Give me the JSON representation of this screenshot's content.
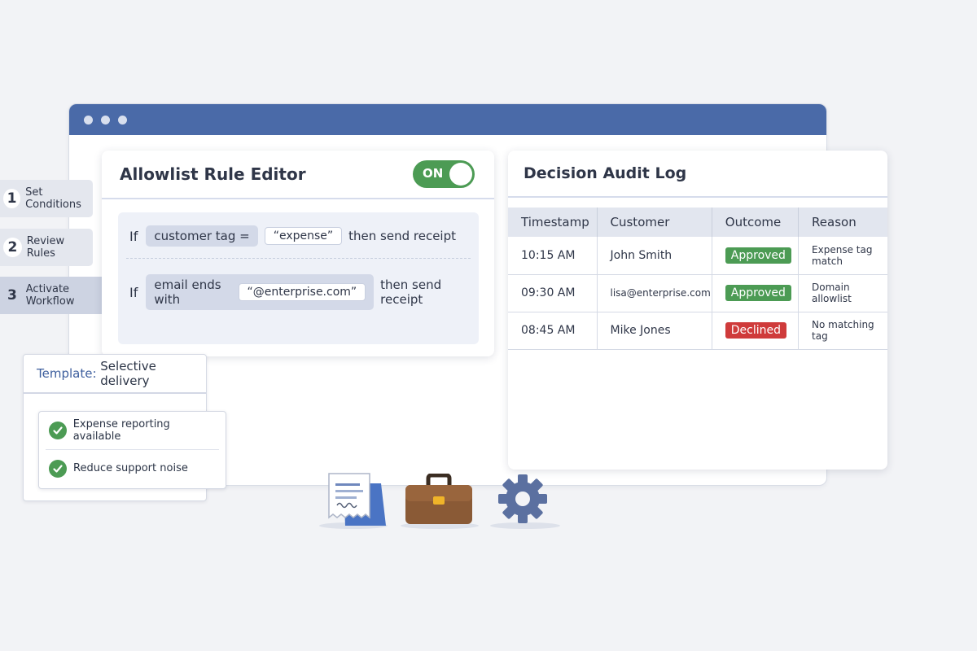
{
  "steps": [
    {
      "number": "1",
      "label": "Set Conditions"
    },
    {
      "number": "2",
      "label": "Review Rules"
    },
    {
      "number": "3",
      "label": "Activate Workflow"
    }
  ],
  "editor": {
    "title": "Allowlist Rule Editor",
    "toggle_label": "ON",
    "rules": [
      {
        "if_label": "If",
        "condition": "customer tag =",
        "value": "“expense”",
        "action": "then send receipt"
      },
      {
        "if_label": "If",
        "condition": "email ends with",
        "value": "“@enterprise.com”",
        "action": "then send receipt"
      }
    ]
  },
  "template": {
    "key": "Template:",
    "value": "Selective delivery",
    "items": [
      "Expense reporting available",
      "Reduce support noise"
    ]
  },
  "audit": {
    "title": "Decision Audit Log",
    "columns": [
      "Timestamp",
      "Customer",
      "Outcome",
      "Reason"
    ],
    "rows": [
      {
        "timestamp": "10:15 AM",
        "customer": "John Smith",
        "outcome": "Approved",
        "reason": "Expense tag match"
      },
      {
        "timestamp": "09:30 AM",
        "customer": "lisa@enterprise.com",
        "outcome": "Approved",
        "reason": "Domain allowlist"
      },
      {
        "timestamp": "08:45 AM",
        "customer": "Mike Jones",
        "outcome": "Declined",
        "reason": "No matching tag"
      }
    ]
  },
  "colors": {
    "titlebar": "#4a6aa8",
    "toggle_on": "#4c9b54",
    "approved": "#4c9b54",
    "declined": "#cf3b3b"
  },
  "icons": [
    "receipt-icon",
    "briefcase-icon",
    "gear-icon"
  ]
}
